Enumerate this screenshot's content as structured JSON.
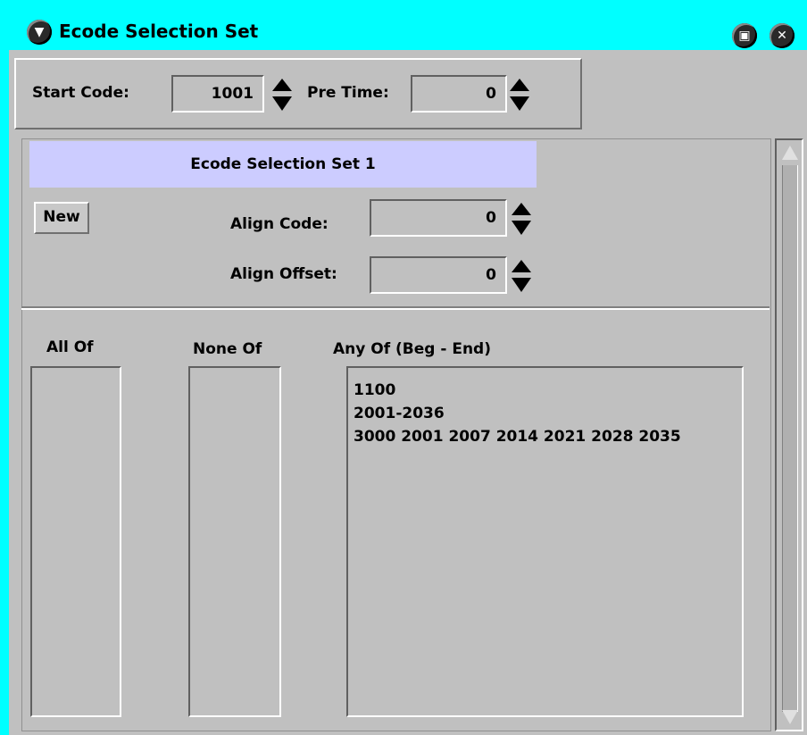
{
  "window": {
    "title": "Ecode Selection Set",
    "accent_color": "#00ffff"
  },
  "icons": {
    "menu": "chevron-down-icon",
    "maximize": "maximize-icon",
    "close": "close-icon"
  },
  "top": {
    "start_code_label": "Start Code:",
    "start_code_value": "1001",
    "pre_time_label": "Pre Time:",
    "pre_time_value": "0"
  },
  "set": {
    "header": "Ecode Selection Set 1",
    "header_color": "#ccccff",
    "new_label": "New",
    "align_code_label": "Align Code:",
    "align_code_value": "0",
    "align_offset_label": "Align Offset:",
    "align_offset_value": "0"
  },
  "lists": {
    "all_of_label": "All Of",
    "none_of_label": "None Of",
    "any_of_label": "Any Of (Beg - End)",
    "any_of_items": [
      "1100",
      "2001-2036",
      "3000 2001 2007 2014 2021 2028 2035"
    ]
  }
}
